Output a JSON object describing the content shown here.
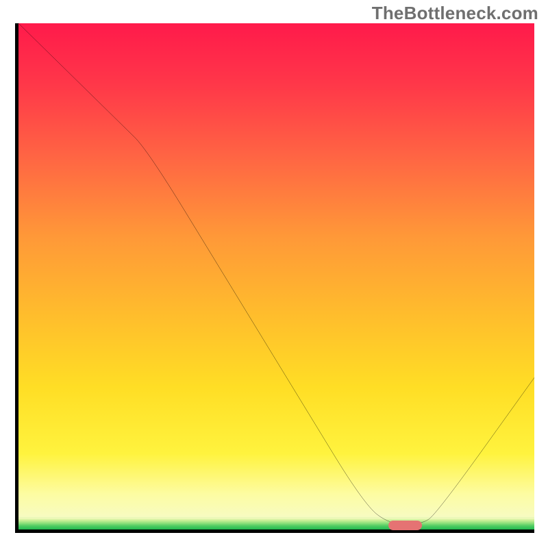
{
  "watermark": "TheBottleneck.com",
  "chart_data": {
    "type": "line",
    "title": "",
    "xlabel": "",
    "ylabel": "",
    "xlim": [
      0,
      100
    ],
    "ylim": [
      0,
      100
    ],
    "grid": false,
    "legend": false,
    "axes_visible": {
      "left": true,
      "bottom": true,
      "ticks": false
    },
    "background_gradient": {
      "orientation": "vertical",
      "stops": [
        {
          "pos": 0.0,
          "color": "#ff1a4b"
        },
        {
          "pos": 0.12,
          "color": "#ff3749"
        },
        {
          "pos": 0.27,
          "color": "#ff6743"
        },
        {
          "pos": 0.42,
          "color": "#ff9838"
        },
        {
          "pos": 0.58,
          "color": "#ffbe2c"
        },
        {
          "pos": 0.72,
          "color": "#ffde25"
        },
        {
          "pos": 0.85,
          "color": "#fff33e"
        },
        {
          "pos": 0.93,
          "color": "#fdfca2"
        },
        {
          "pos": 0.975,
          "color": "#f7fbc1"
        },
        {
          "pos": 0.984,
          "color": "#90e17c"
        },
        {
          "pos": 1.0,
          "color": "#22b94f"
        }
      ]
    },
    "series": [
      {
        "name": "bottleneck-curve",
        "color": "#000000",
        "stroke_width": 2,
        "x": [
          0,
          10,
          20,
          25,
          40,
          55,
          67,
          72,
          78,
          81,
          100
        ],
        "y": [
          100,
          90,
          80,
          75,
          50,
          25,
          5,
          1,
          1,
          3,
          30
        ]
      }
    ],
    "markers": [
      {
        "name": "optimal-marker",
        "shape": "rounded-bar",
        "color": "#e57373",
        "x": 75,
        "y": 0.8,
        "width_pct": 6.5,
        "height_pct": 1.9
      }
    ]
  }
}
